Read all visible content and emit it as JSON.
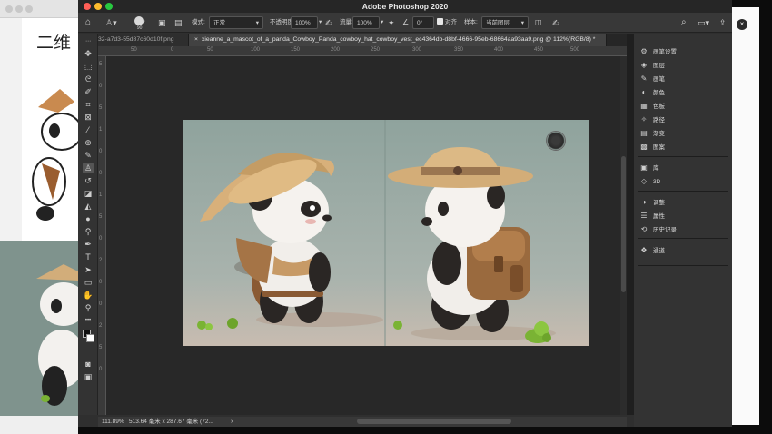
{
  "bg_window": {
    "heading": "二维"
  },
  "app": {
    "title": "Adobe Photoshop 2020"
  },
  "options_bar": {
    "mode_label": "模式:",
    "mode_value": "正常",
    "opacity_label": "不透明度:",
    "opacity_value": "100%",
    "flow_label": "流量:",
    "flow_value": "100%",
    "angle_value": "0°",
    "align_label": "对齐",
    "sample_label": "样本:",
    "sample_value": "当前图层",
    "brush_size": "90"
  },
  "tabs": [
    {
      "label": "32-a7d3-55d87c60d10f.png"
    },
    {
      "label": "xieanne_a_mascot_of_a_panda_Cowboy_Panda_cowboy_hat_cowboy_vest_ec4364db-d8bf-4666-95eb-68664aa93aa9.png @ 112%(RGB/8) *"
    }
  ],
  "ruler_labels": [
    "50",
    "0",
    "50",
    "100",
    "150",
    "200",
    "250",
    "300",
    "350",
    "400",
    "450",
    "500"
  ],
  "ruler_left_labels": [
    "5",
    "0",
    "5",
    "1",
    "0",
    "0",
    "1",
    "5",
    "0",
    "2",
    "0",
    "0",
    "2",
    "5",
    "0"
  ],
  "panels": [
    {
      "label": "画笔设置",
      "icon": "brush-settings-icon",
      "glyph": "⚙"
    },
    {
      "label": "图层",
      "icon": "layers-icon",
      "glyph": "◈"
    },
    {
      "label": "画笔",
      "icon": "brush-icon",
      "glyph": "✎"
    },
    {
      "label": "颜色",
      "icon": "color-icon",
      "glyph": "◐"
    },
    {
      "label": "色板",
      "icon": "swatches-icon",
      "glyph": "▦"
    },
    {
      "label": "路径",
      "icon": "paths-icon",
      "glyph": "✧"
    },
    {
      "label": "渐变",
      "icon": "gradient-icon",
      "glyph": "▤"
    },
    {
      "label": "图案",
      "icon": "patterns-icon",
      "glyph": "▩"
    },
    {
      "label": "库",
      "icon": "libraries-icon",
      "glyph": "▣"
    },
    {
      "label": "3D",
      "icon": "3d-icon",
      "glyph": "◇"
    },
    {
      "label": "调整",
      "icon": "adjustments-icon",
      "glyph": "◑"
    },
    {
      "label": "属性",
      "icon": "properties-icon",
      "glyph": "☰"
    },
    {
      "label": "历史记录",
      "icon": "history-icon",
      "glyph": "⟲"
    },
    {
      "label": "通道",
      "icon": "channels-icon",
      "glyph": "❖"
    }
  ],
  "status": {
    "zoom": "111.89%",
    "size": "513.64 毫米 x 287.67 毫米 (72..."
  },
  "colors": {
    "doc_bg": "#8fa39d",
    "hat": "#cfa774",
    "bag": "#9a6a3e",
    "accent": "#7ab334"
  }
}
